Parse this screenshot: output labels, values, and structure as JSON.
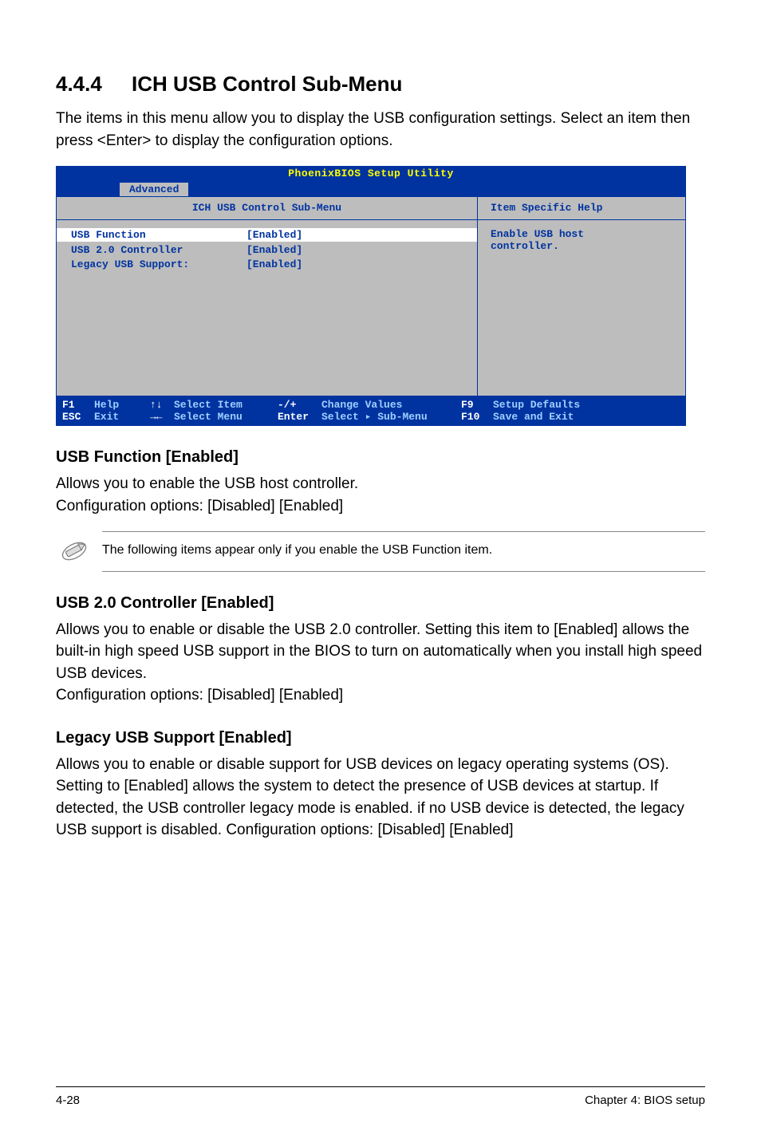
{
  "section": {
    "number": "4.4.4",
    "title": "ICH USB Control Sub-Menu",
    "intro": "The items in this menu allow you to display the USB configuration settings. Select an item then press <Enter> to display the configuration options."
  },
  "bios": {
    "utility_title": "PhoenixBIOS Setup Utility",
    "active_tab": "Advanced",
    "left_head": "ICH USB Control Sub-Menu",
    "right_head": "Item Specific Help",
    "rows": [
      {
        "label": "USB Function",
        "value": "[Enabled]",
        "hl": true
      },
      {
        "label": "",
        "value": "",
        "hl": false
      },
      {
        "label": "USB 2.0 Controller",
        "value": "[Enabled]",
        "hl": false
      },
      {
        "label": "Legacy USB Support:",
        "value": "[Enabled]",
        "hl": false
      }
    ],
    "help_text_line1": "Enable USB host",
    "help_text_line2": "controller.",
    "footer": {
      "f1": "F1",
      "f1d": "Help",
      "ud": "↑↓",
      "udd": "Select Item",
      "mp": "-/+",
      "mpd": "Change Values",
      "f9": "F9",
      "f9d": "Setup Defaults",
      "esc": "ESC",
      "escd": "Exit",
      "lr": "→←",
      "lrd": "Select Menu",
      "en": "Enter",
      "end": "Select ▸ Sub-Menu",
      "f10": "F10",
      "f10d": "Save and Exit"
    }
  },
  "subsections": {
    "usb_function": {
      "title": "USB Function [Enabled]",
      "p1": "Allows you to enable the USB host controller.",
      "p2": "Configuration options: [Disabled] [Enabled]"
    },
    "note": "The following items appear only if you enable the USB Function item.",
    "usb20": {
      "title": "USB 2.0 Controller [Enabled]",
      "p1": "Allows you to enable or disable the USB 2.0 controller. Setting this item to [Enabled] allows the built-in high speed USB support in the BIOS to turn on automatically when you install high speed USB devices.",
      "p2": "Configuration options: [Disabled] [Enabled]"
    },
    "legacy": {
      "title": "Legacy USB Support [Enabled]",
      "p1": "Allows you to enable or disable support for USB devices on legacy operating systems (OS). Setting to [Enabled] allows the system to detect the presence of USB devices at startup. If detected, the USB controller legacy mode is enabled. if no USB device is detected, the legacy USB support is disabled. Configuration options: [Disabled] [Enabled]"
    }
  },
  "page_footer": {
    "left": "4-28",
    "right": "Chapter 4: BIOS setup"
  }
}
